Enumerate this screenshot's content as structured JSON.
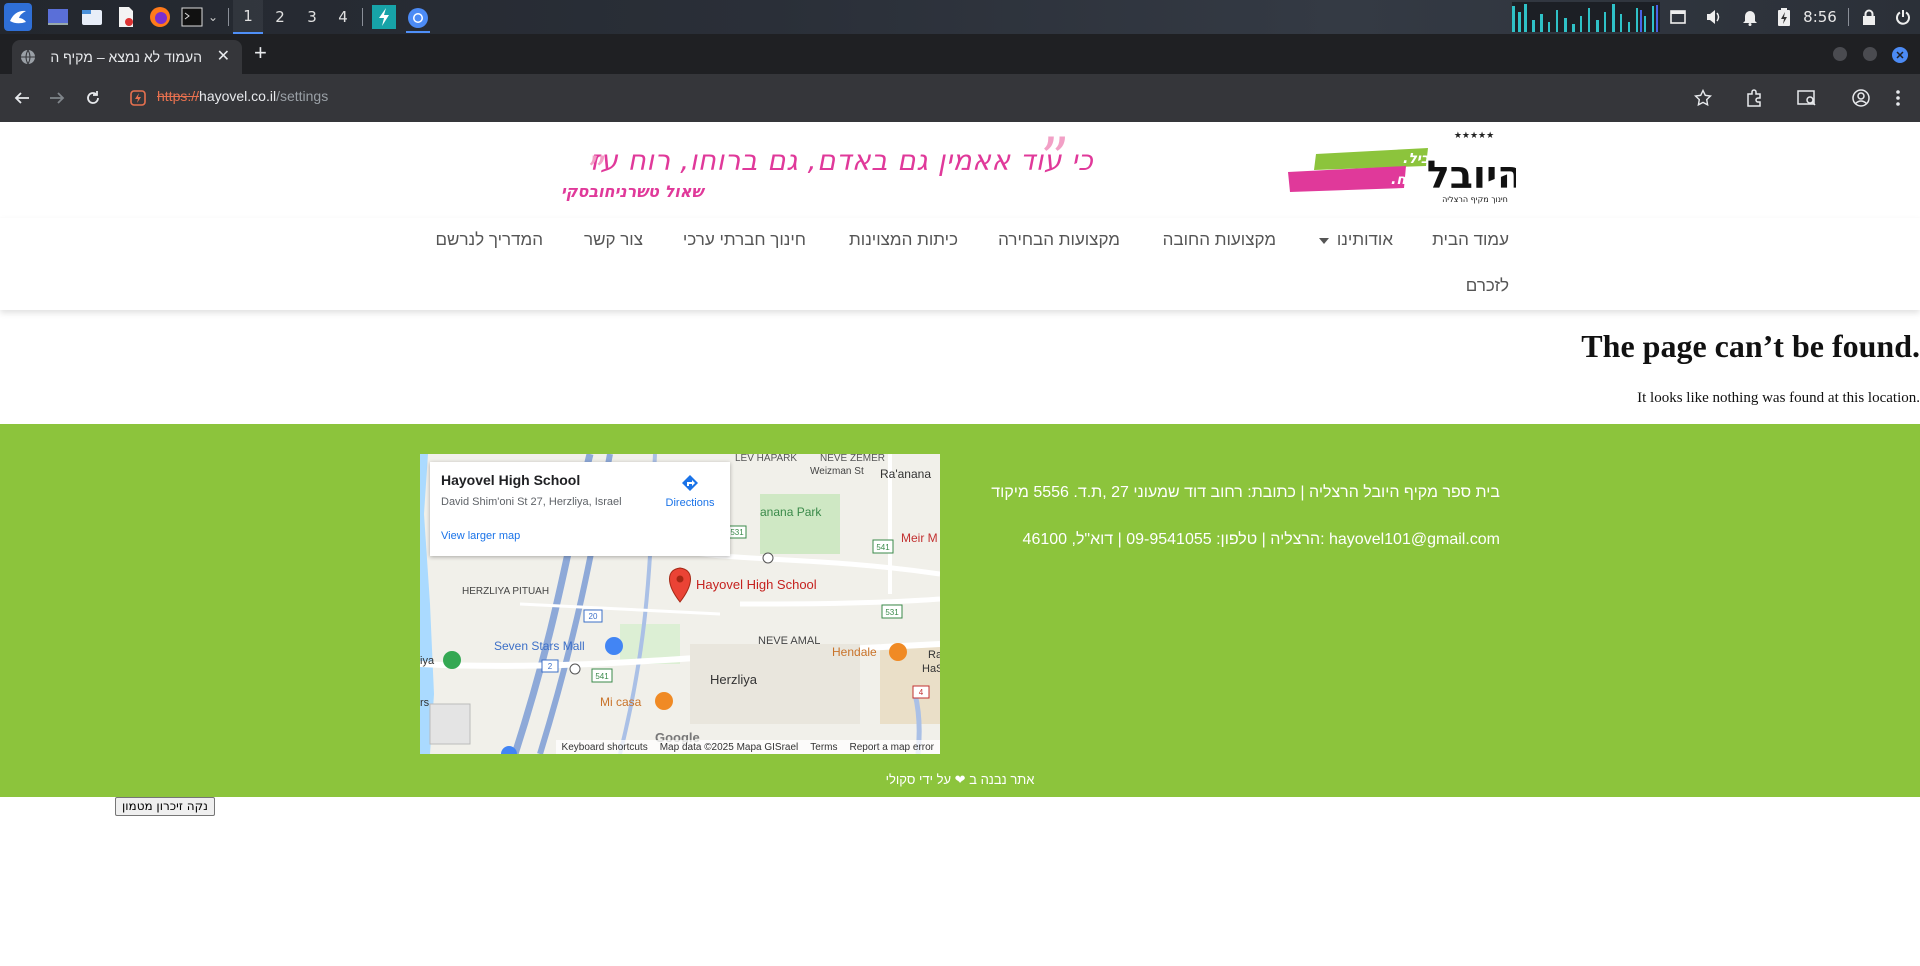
{
  "taskbar": {
    "workspaces": [
      "1",
      "2",
      "3",
      "4"
    ],
    "clock": "8:56"
  },
  "browser": {
    "tab_title": "העמוד לא נמצא – מקיף ה",
    "url_scheme": "https://",
    "url_host": "hayovel.co.il",
    "url_path": "/settings"
  },
  "header": {
    "logo_slogan_1": "לומדים להוביל.",
    "logo_slogan_2": "לומדים להצליח.",
    "logo_name": "היובל",
    "logo_subtitle": "חינוך מקיף הרצליה",
    "quote": "כי עוד אאמין גם באדם, גם ברוחו, רוח עז",
    "author": "שאול טשרניחובסקי"
  },
  "nav": {
    "items": [
      "עמוד הבית",
      "אודותינו",
      "מקצועות החובה",
      "מקצועות הבחירה",
      "כיתות המצוינות",
      "חינוך חברתי ערכי",
      "צור קשר",
      "המדריך לנרשם"
    ],
    "second_row": "לזכרם"
  },
  "content": {
    "title": "The page can’t be found.",
    "message": "It looks like nothing was found at this location."
  },
  "footer": {
    "line1": "בית ספר מקיף היובל הרצליה | כתובת: רחוב דוד שמעוני 27 ,ת.ד. 5556 מיקוד",
    "line2": "46100 ,הרצליה | טלפון: 09-9541055 | דוא\"ל: hayovel101@gmail.com",
    "copyright": "אתר נבנה ב ❤ על ידי סקולי"
  },
  "map": {
    "place_name": "Hayovel High School",
    "address": "David Shim'oni St 27, Herzliya, Israel",
    "directions": "Directions",
    "larger_map": "View larger map",
    "labels": {
      "lev_hapark": "LEV HAPARK",
      "neve_zemer": "NEVE ZEMER",
      "weizman": "Weizman St",
      "raanana": "Ra'anana",
      "raanana_park": "anana Park",
      "meir": "Meir M",
      "herzliya_pituah": "HERZLIYA PITUAH",
      "neve_amal": "NEVE AMAL",
      "seven_stars": "Seven Stars Mall",
      "herzliya": "Herzliya",
      "hendale": "Hendale",
      "mi_casa": "Mi casa",
      "iya": "iya",
      "ra": "Ra",
      "has": "HaS",
      "rs": "rs",
      "marker": "Hayovel High School",
      "r531a": "531",
      "r541": "541",
      "r531b": "531",
      "r20": "20",
      "r2": "2",
      "r541b": "541",
      "r4": "4",
      "google": "Google"
    },
    "credits": [
      "Keyboard shortcuts",
      "Map data ©2025 Mapa GISrael",
      "Terms",
      "Report a map error"
    ]
  },
  "clear_cache_button": "נקה זיכרון מטמון",
  "colors": {
    "footer_green": "#8cc43c",
    "quote_pink": "#e0399a",
    "browser_dark": "#35363a"
  }
}
